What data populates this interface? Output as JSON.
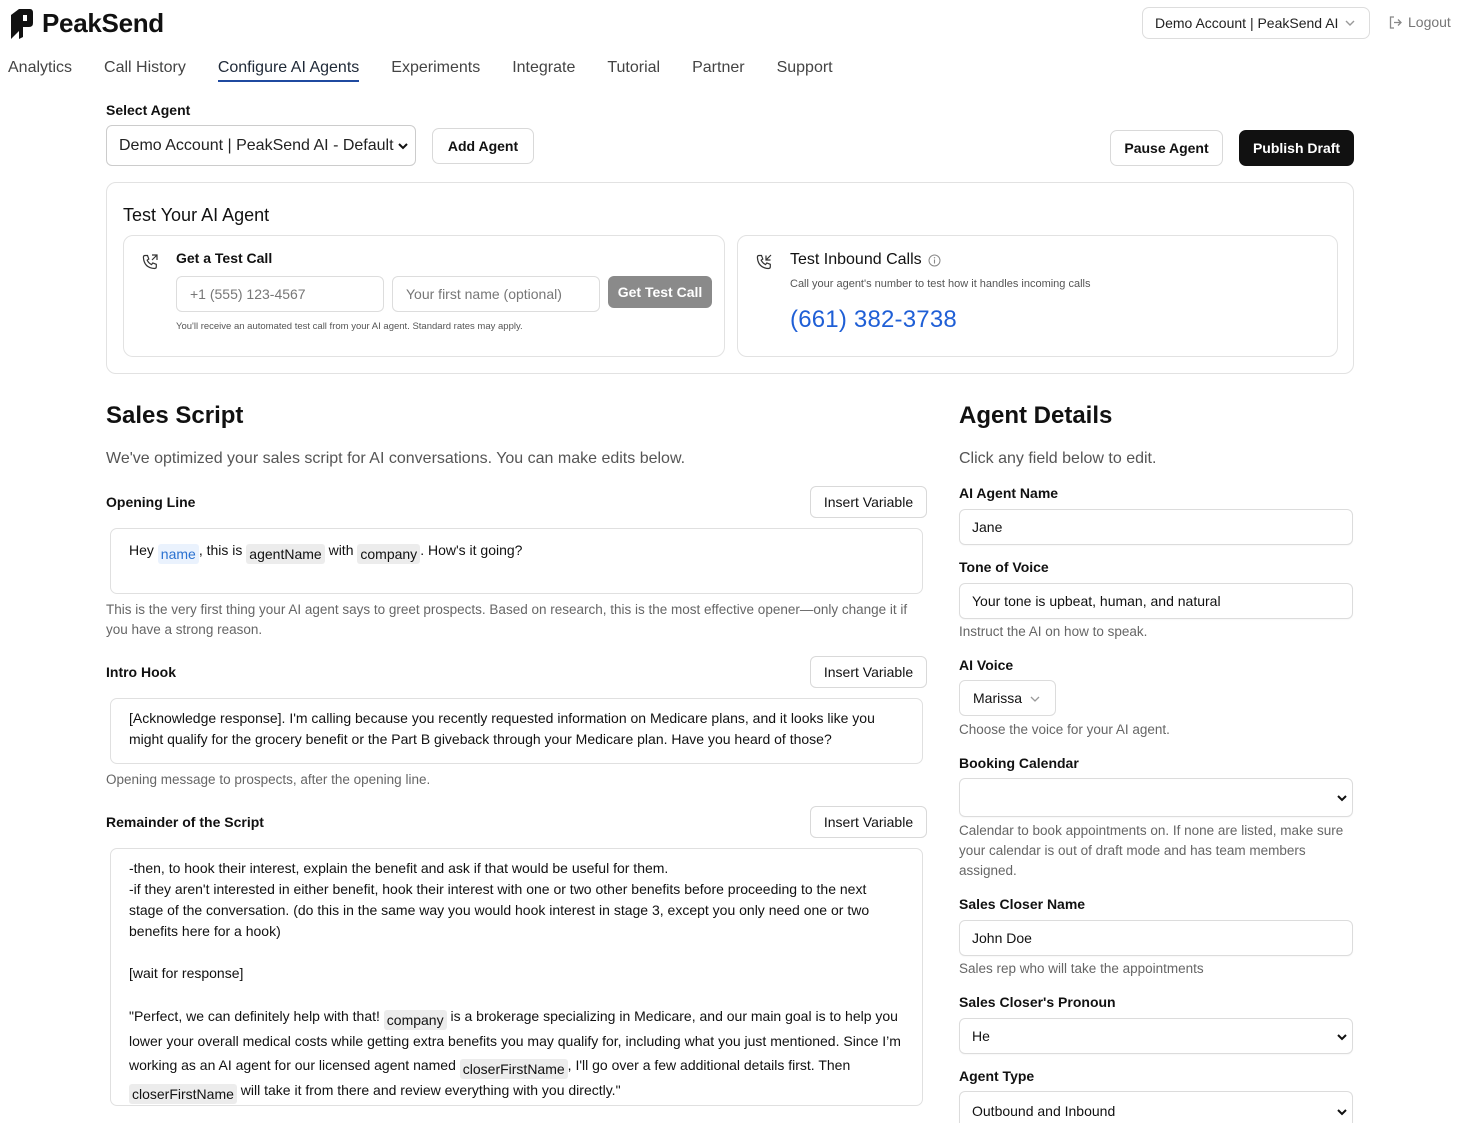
{
  "brand": {
    "name": "PeakSend"
  },
  "account": {
    "selected": "Demo Account | PeakSend AI",
    "logout_label": "Logout"
  },
  "nav": {
    "tabs": [
      "Analytics",
      "Call History",
      "Configure AI Agents",
      "Experiments",
      "Integrate",
      "Tutorial",
      "Partner",
      "Support"
    ],
    "active_index": 2
  },
  "agent_bar": {
    "select_label": "Select Agent",
    "selected_agent": "Demo Account | PeakSend AI - Default",
    "add_label": "Add Agent",
    "pause_label": "Pause Agent",
    "publish_label": "Publish Draft"
  },
  "test": {
    "title": "Test Your AI Agent",
    "call": {
      "title": "Get a Test Call",
      "phone_placeholder": "+1 (555) 123-4567",
      "name_placeholder": "Your first name (optional)",
      "button_label": "Get Test Call",
      "note": "You'll receive an automated test call from your AI agent. Standard rates may apply."
    },
    "inbound": {
      "title": "Test Inbound Calls",
      "description": "Call your agent's number to test how it handles incoming calls",
      "number": "(661) 382-3738"
    }
  },
  "script": {
    "title": "Sales Script",
    "lead": "We've optimized your sales script for AI conversations. You can make edits below.",
    "insert_variable_label": "Insert Variable",
    "opening": {
      "label": "Opening Line",
      "t1": "Hey ",
      "v1": "name",
      "t2": ", this is ",
      "v2": "agentName",
      "t3": " with ",
      "v3": "company",
      "t4": ". How's it going?",
      "help": "This is the very first thing your AI agent says to greet prospects. Based on research, this is the most effective opener—only change it if you have a strong reason."
    },
    "hook": {
      "label": "Intro Hook",
      "text": "[Acknowledge response]. I'm calling because you recently requested information on Medicare plans, and it looks like you might qualify for the grocery benefit or the Part B giveback through your Medicare plan. Have you heard of those?",
      "help": "Opening message to prospects, after the opening line."
    },
    "remainder": {
      "label": "Remainder of the Script",
      "line1": "-then, to hook their interest, explain the benefit and ask if that would be useful for them.",
      "line2": "-if they aren't interested in either benefit, hook their interest with one or two other benefits before proceeding to the next stage of the conversation. (do this in the same way you would hook interest in stage 3, except you only need one or two benefits here for a hook)",
      "line3": "[wait for response]",
      "q1": "\"Perfect, we can definitely help with that! ",
      "v1": "company",
      "q2": " is a brokerage specializing in Medicare, and our main goal is to help you lower your overall medical costs while getting extra benefits you may qualify for, including what you just mentioned. Since I’m working as an AI agent for our licensed agent named ",
      "v2": "closerFirstName",
      "q3": ", I'll go over a few additional details first. Then ",
      "v3": "closerFirstName",
      "q4": " will take it from there and review everything with you directly.\""
    }
  },
  "details": {
    "title": "Agent Details",
    "lead": "Click any field below to edit.",
    "name_label": "AI Agent Name",
    "name_value": "Jane",
    "tone_label": "Tone of Voice",
    "tone_value": "Your tone is upbeat, human, and natural",
    "tone_help": "Instruct the AI on how to speak.",
    "voice_label": "AI Voice",
    "voice_value": "Marissa",
    "voice_help": "Choose the voice for your AI agent.",
    "calendar_label": "Booking Calendar",
    "calendar_value": "",
    "calendar_help": "Calendar to book appointments on. If none are listed, make sure your calendar is out of draft mode and has team members assigned.",
    "closer_label": "Sales Closer Name",
    "closer_value": "John Doe",
    "closer_help": "Sales rep who will take the appointments",
    "pronoun_label": "Sales Closer's Pronoun",
    "pronoun_value": "He",
    "type_label": "Agent Type",
    "type_value": "Outbound and Inbound"
  },
  "colors": {
    "accent": "#1f5fd6",
    "primary_button": "#111111",
    "disabled_button": "#8a8a8a",
    "variable_chip": "#ececec"
  }
}
